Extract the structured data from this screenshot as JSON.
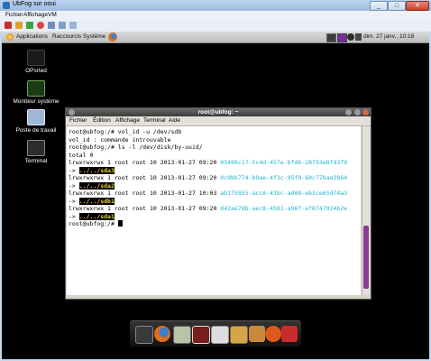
{
  "host": {
    "window_title": "UbFog sur ooui",
    "menu": [
      "Fichier",
      "Affichage",
      "VM"
    ]
  },
  "guest_panel": {
    "menus": [
      "Applications",
      "Raccourcis",
      "Système"
    ],
    "clock": "dim. 27 janv., 10:18"
  },
  "desktop_icons": [
    {
      "label": "OPsrted",
      "icon": "folder-icon"
    },
    {
      "label": "Moniteur système",
      "icon": "system-monitor-icon"
    },
    {
      "label": "Poste de travail",
      "icon": "computer-icon"
    },
    {
      "label": "Terminal",
      "icon": "terminal-icon"
    }
  ],
  "terminal": {
    "title": "root@ubfog: ~",
    "menu": [
      "Fichier",
      "Édition",
      "Affichage",
      "Terminal",
      "Aide"
    ],
    "lines": {
      "l1": "root@ubfog:/# vol_id -u /dev/sdb",
      "l2": "vol_id : commande introuvable",
      "l3": "root@ubfog:/# ls -l /dev/disk/by-uuid/",
      "l4": "total 0",
      "l5_perm": "lrwxrwxrwx 1 root root 10 2013-01-27 09:20 ",
      "l5_uuid": "05499c17-5c4d-457e-bfd6-28793e8fd3f9",
      "l6_arrow": "-> ",
      "l6_target": "../../sda3",
      "l7_perm": "lrwxrwxrwx 1 root root 10 2013-01-27 09:20 ",
      "l7_uuid": "0c9bb774-b9ae-4f3c-95f0-60c77bae2864",
      "l8_arrow": "-> ",
      "l8_target": "../../sda2",
      "l9_perm": "lrwxrwxrwx 1 root root 10 2013-01-27 10:03 ",
      "l9_uuid": "ab175855-acc6-41bc-ad08-eb3ce65d74a3",
      "l10_arrow": "-> ",
      "l10_target": "../../sdb1",
      "l11_perm": "lrwxrwxrwx 1 root root 10 2013-01-27 09:20 ",
      "l11_uuid": "d42ae78b-aec8-4581-a96f-ef8747924b2e",
      "l12_arrow": "-> ",
      "l12_target": "../../sda1",
      "l13": "root@ubfog:/# "
    }
  },
  "dock_items": [
    "terminal-icon",
    "firefox-icon",
    "calculator-icon",
    "presentation-icon",
    "image-viewer-icon",
    "files-icon",
    "package-icon",
    "ubuntu-icon",
    "power-icon"
  ],
  "colors": {
    "uuid_link": "#1fb4cf",
    "highlight_fg": "#f0d23a",
    "scrollbar_thumb": "#8b3a96"
  }
}
